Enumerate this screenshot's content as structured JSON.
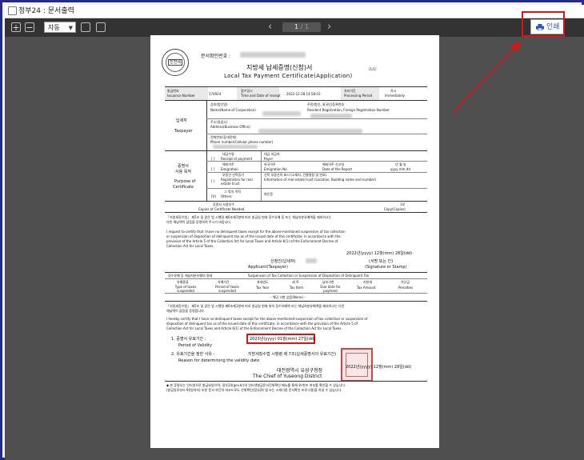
{
  "window": {
    "title": "정부24 : 문서출력"
  },
  "toolbar": {
    "zoom_in": "+",
    "zoom_out": "−",
    "zoom_value": "자동",
    "page_current": "1",
    "page_sep": "/",
    "page_total": "1",
    "prev": "‹",
    "next": "›",
    "print_label": "인쇄"
  },
  "document": {
    "doc_confirm_label": "문서확인번호 :",
    "title_ko": "지방세 납세증명(신청)서",
    "title_en": "Local Tax Payment Certificate(Application)",
    "page_of": "(1/1)",
    "seal_text": "진천세",
    "header_row": {
      "issuance_ko": "발급번호",
      "issuance_en": "Issuance Number",
      "issuance_val": "174924",
      "date_ko": "접수일시",
      "date_en": "Time and Date of receipt",
      "date_val": "2022-12-28 14:58:03",
      "period_ko": "처리기간",
      "period_en": "Processing Period",
      "period_val": "즉시",
      "period_val_en": "Immediately"
    },
    "taxpayer": {
      "label_ko": "납세자",
      "label_en": "Taxpayer",
      "name_ko": "상호(법인명)",
      "name_en": "Name(Name of Corporation)",
      "id_ko": "주민(법인, 외국인)등록번호",
      "id_en": "Resident Registration, Foreign Registration Number",
      "addr_ko": "주소(영업소)",
      "addr_en": "Address(Business Office)",
      "phone_ko": "전화번호(휴대전화)",
      "phone_en": "Phone number(Cellular phone number)"
    },
    "purpose": {
      "label_ko": "증명서",
      "label_ko2": "사용 목적",
      "label_en": "Purpose of",
      "label_en2": "Certificate",
      "items": [
        {
          "mark": "[ ]",
          "ko": "대금수령",
          "en": "Receipt of payment",
          "right_ko": "대금 지급자",
          "right_en": "Payer"
        },
        {
          "mark": "[ ]",
          "ko": "해외이주",
          "en": "Emigration",
          "right_ko": "외국이주",
          "right_en": "Emigration No.",
          "extra_ko": "해외이주 신고일",
          "extra_en": "Date of the Report",
          "date_ko": "년 월 일",
          "date_en": "yyyy mm dd"
        },
        {
          "mark": "[ ]",
          "ko": "부동산 신탁등기",
          "en": "Registration for real estate trust",
          "right_ko": "신탁 부동산의 표시 (소재지, 건물명칭 및 번호)",
          "right_en": "Information of real estate trust (Location, Building name and number)"
        },
        {
          "mark": "[V]",
          "ko": "그 밖의 목적",
          "en": "Others",
          "right_ko": "회인증",
          "right_en": ""
        }
      ]
    },
    "copies": {
      "ko": "증명서 사용부수",
      "en": "Copies of Certificate Needed",
      "right": "1부",
      "right_en": "Copy(Copies)"
    },
    "request_ko_1": "「지방세징수법」 제5조 및 같은 법 시행령 제6조제1항에 따라 발급일 현재 징수유예 등 또는 체납처분유예액을 제외하고는",
    "request_ko_2": "다른 체납액이 없음을 증명하여 주시기 바랍니다.",
    "request_en_1": "I request to certify that I have no delinquent taxes except for the above-mentioned suspension of tax collection",
    "request_en_2": "or suspension of disposition of delinquent tax as of the issued date of this certificate, in accordance with the",
    "request_en_3": "provision of the Article 5 of the Collection Act for Local Taxes and Article 6(1) of the Enforcement Decree of",
    "request_en_4": "Collection Act for Local Taxes.",
    "req_date": "2022년(yyyy) 12월(mm) 28일(dd)",
    "applicant_ko": "신청인(납세자)",
    "applicant_en": "Applicant(Taxpayer)",
    "sign_ko": "(서명 또는 인)",
    "sign_en": "(Signature or Stamp)",
    "suspension": {
      "title_ko": "징수유예 등 체납처분유예의 명세",
      "title_en": "Suspension of Tax Collection or Suspension of Disposition of Delinquent Tax",
      "columns": [
        {
          "ko": "유예종류",
          "en": "Type of taxes suspended"
        },
        {
          "ko": "유예기간",
          "en": "Period of taxes suspended"
        },
        {
          "ko": "과세연도",
          "en": "Tax Year"
        },
        {
          "ko": "세 목",
          "en": "Tax Item"
        },
        {
          "ko": "납부기한",
          "en": "Due date for payment"
        },
        {
          "ko": "지방세",
          "en": "Tax Amount"
        },
        {
          "ko": "가산금",
          "en": "Penalties"
        }
      ],
      "none_row": "- 해당 사항 없음(None) -"
    },
    "cert_ko_1": "「지방세징수법」 제5조 및 같은 법 시행령 제6조제1항에 따라 발급일 현재 위의 징수유예액 또는 체납처분유예액을 제외하고는 다른",
    "cert_ko_2": "체납액이 없음을 증명합니다.",
    "cert_en_1": "I hereby certify that I have no delinquent taxes except for the above-mentioned suspension of tax collection or suspension of",
    "cert_en_2": "disposition of delinquent tax as of the issued date of this certificate, in accordance with the provision of the Article 5 of",
    "cert_en_3": "Collection Act for Local Taxes and Article 6(1) of the Enforcement Decree of the Collection Act for Local Taxes.",
    "validity_ko": "1. 증명서 유효기간 :",
    "validity_en": "Period of Validity",
    "validity_val": "2023년(yyyy) 01월(mm) 27일(dd)",
    "reason_ko": "2. 유효기간을 정한 사유 :",
    "reason_en": "Reason for determining the validity date",
    "reason_val": "지방세징수법 시행령 제 7조(납세증명서의 유효기간)",
    "issue_date": "2022년(yyyy) 12월(mm) 28일(dd)",
    "chief_ko": "대전광역시 유성구청장",
    "chief_en": "The Chief of  Yuseong District",
    "footnote_1": "◆ 본 증명서는 인터넷으로 발급되었으며, 정부24(gov.kr)의 인터넷발급문서진위확인 메뉴를 통해 위·변조 여부를 확인할 수 있습니다.",
    "footnote_2": "  (발급일로부터 90일까지) 또한 문서 하단의 바코드로도 진위확인(정부24 앱 또는 스캐너용 문서확인 프로그램)을 하실 수 있습니다."
  }
}
